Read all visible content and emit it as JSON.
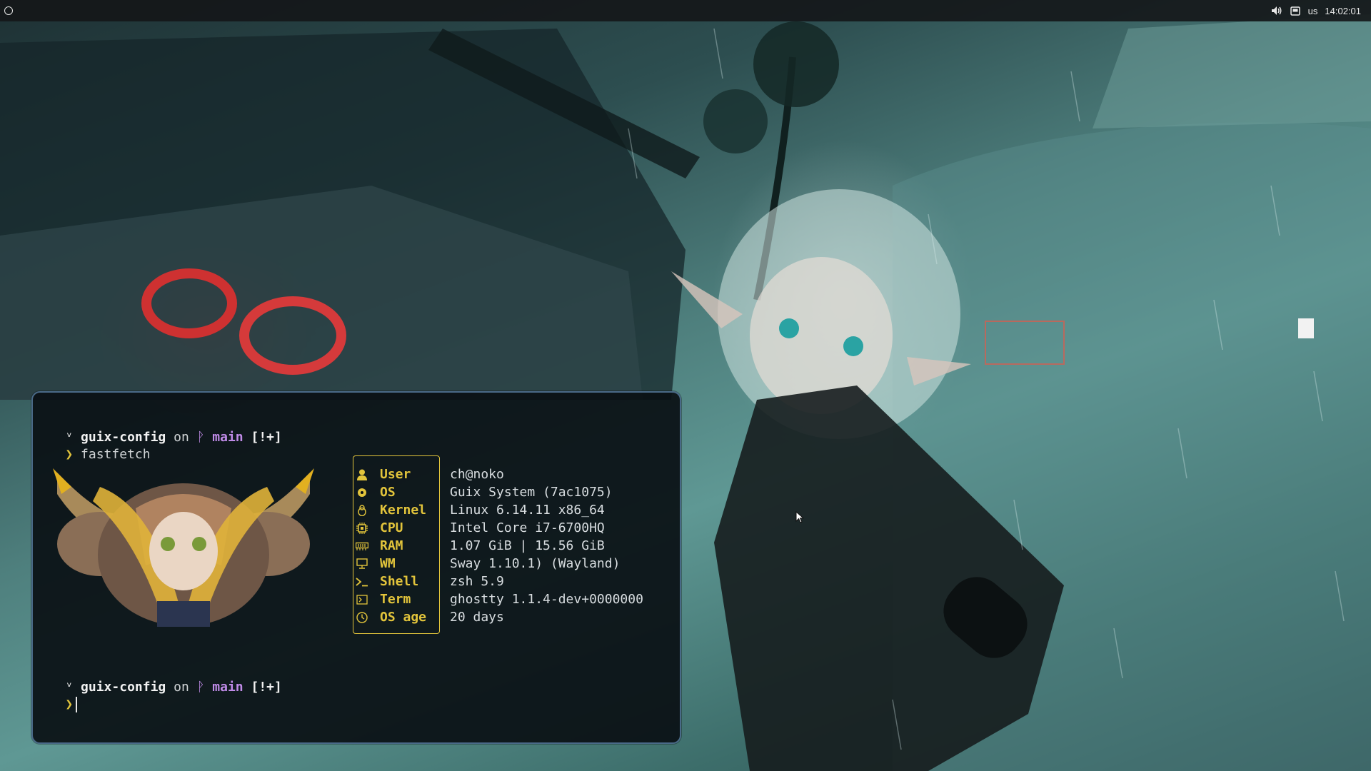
{
  "topbar": {
    "keyboard_layout": "us",
    "clock": "14:02:01",
    "icons": [
      "volume-icon",
      "tray-window-icon"
    ]
  },
  "terminal": {
    "prompt1": {
      "dir": "guix-config",
      "on": "on",
      "branch_symbol": "ᚹ",
      "branch": "main",
      "status": "[!+]"
    },
    "command": "fastfetch",
    "prompt2": {
      "dir": "guix-config",
      "on": "on",
      "branch_symbol": "ᚹ",
      "branch": "main",
      "status": "[!+]"
    },
    "prompt_char": "❯",
    "fastfetch": {
      "rows": [
        {
          "key": "User",
          "value": "ch@noko",
          "icon": "user-icon"
        },
        {
          "key": "OS",
          "value": "Guix System (7ac1075)",
          "icon": "os-icon"
        },
        {
          "key": "Kernel",
          "value": "Linux 6.14.11 x86_64",
          "icon": "kernel-icon"
        },
        {
          "key": "CPU",
          "value": "Intel Core i7-6700HQ",
          "icon": "cpu-icon"
        },
        {
          "key": "RAM",
          "value": "1.07 GiB | 15.56 GiB",
          "icon": "ram-icon"
        },
        {
          "key": "WM",
          "value": "Sway 1.10.1) (Wayland)",
          "icon": "monitor-icon"
        },
        {
          "key": "Shell",
          "value": "zsh 5.9",
          "icon": "shell-icon"
        },
        {
          "key": "Term",
          "value": "ghostty 1.1.4-dev+0000000",
          "icon": "terminal-icon"
        },
        {
          "key": "OS age",
          "value": "20 days",
          "icon": "clock-icon"
        }
      ]
    }
  },
  "colors": {
    "accent_yellow": "#e2c43b",
    "branch_purple": "#c08be8",
    "terminal_border": "#4a6a88",
    "terminal_bg": "#0a1014"
  }
}
